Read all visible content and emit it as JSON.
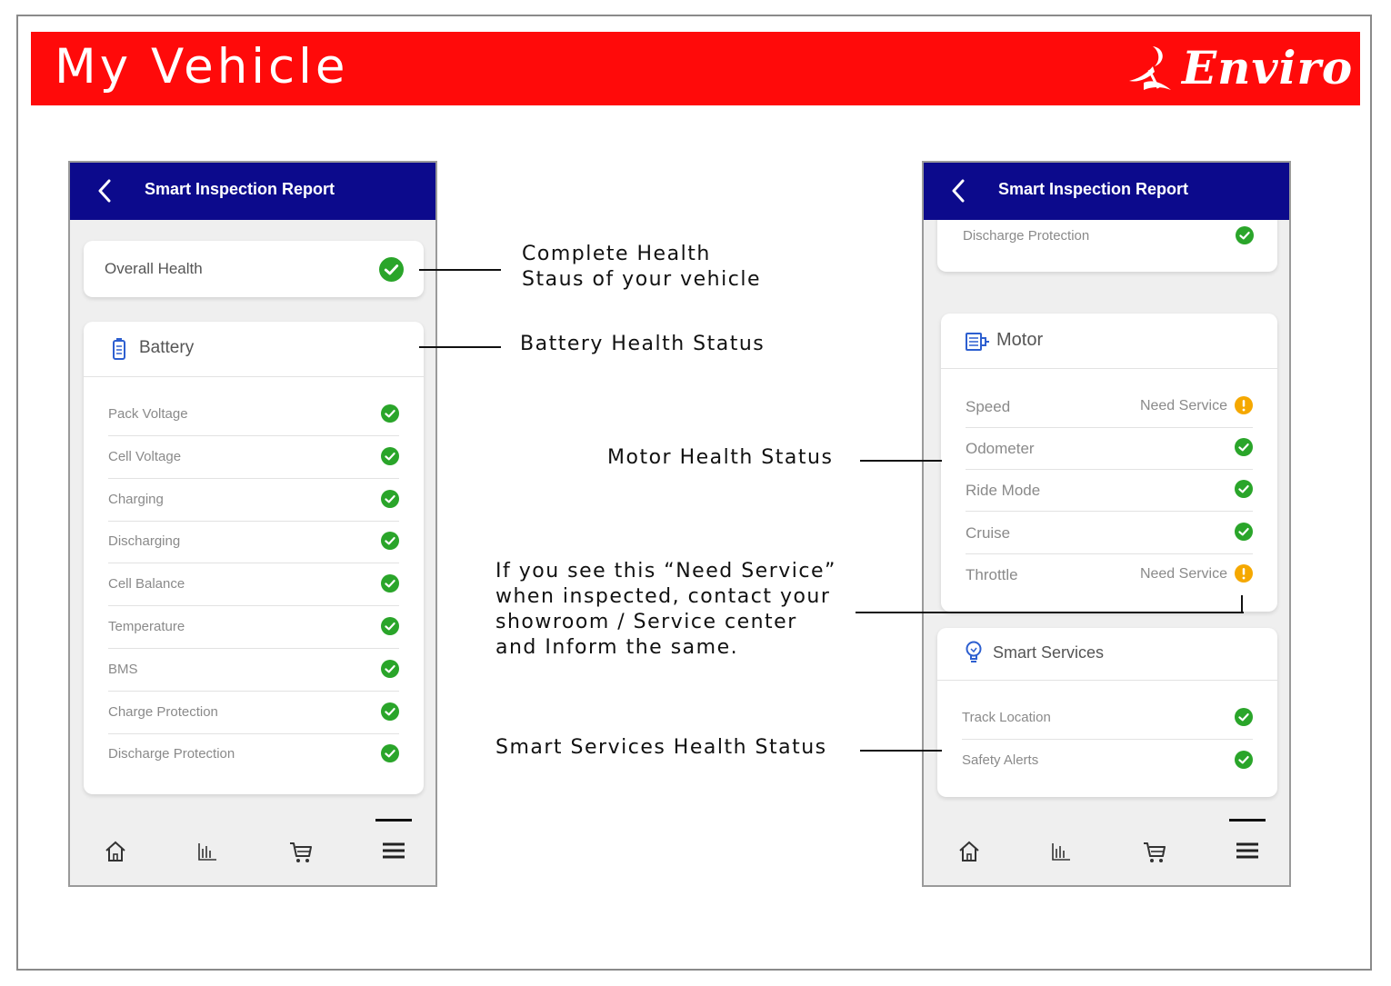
{
  "page": {
    "title": "My Vehicle",
    "brand": "Enviro"
  },
  "colors": {
    "banner": "#ff0a0a",
    "appbar": "#0c0a8c",
    "ok": "#2aa52a",
    "warn": "#f5a800"
  },
  "left_phone": {
    "header": {
      "title": "Smart Inspection Report"
    },
    "overall": {
      "label": "Overall Health",
      "status": "ok"
    },
    "battery": {
      "title": "Battery",
      "icon": "battery-icon",
      "items": [
        {
          "label": "Pack Voltage",
          "status": "ok"
        },
        {
          "label": "Cell Voltage",
          "status": "ok"
        },
        {
          "label": "Charging",
          "status": "ok"
        },
        {
          "label": "Discharging",
          "status": "ok"
        },
        {
          "label": "Cell Balance",
          "status": "ok"
        },
        {
          "label": "Temperature",
          "status": "ok"
        },
        {
          "label": "BMS",
          "status": "ok"
        },
        {
          "label": "Charge Protection",
          "status": "ok"
        },
        {
          "label": "Discharge Protection",
          "status": "ok"
        }
      ]
    },
    "nav": [
      "home-icon",
      "stats-icon",
      "cart-icon",
      "menu-icon"
    ]
  },
  "right_phone": {
    "header": {
      "title": "Smart Inspection Report"
    },
    "top_row": {
      "label": "Discharge Protection",
      "status": "ok"
    },
    "motor": {
      "title": "Motor",
      "icon": "motor-icon",
      "items": [
        {
          "label": "Speed",
          "status": "warn",
          "status_text": "Need Service"
        },
        {
          "label": "Odometer",
          "status": "ok"
        },
        {
          "label": "Ride Mode",
          "status": "ok"
        },
        {
          "label": "Cruise",
          "status": "ok"
        },
        {
          "label": "Throttle",
          "status": "warn",
          "status_text": "Need Service"
        }
      ]
    },
    "smart": {
      "title": "Smart Services",
      "icon": "bulb-icon",
      "items": [
        {
          "label": "Track Location",
          "status": "ok"
        },
        {
          "label": "Safety Alerts",
          "status": "ok"
        }
      ]
    },
    "nav": [
      "home-icon",
      "stats-icon",
      "cart-icon",
      "menu-icon"
    ]
  },
  "annotations": {
    "overall_line1": "Complete Health",
    "overall_line2": "Staus of your vehicle",
    "battery": "Battery Health Status",
    "motor": "Motor Health Status",
    "service_line1": "If you see this “Need Service”",
    "service_line2": "when inspected, contact your",
    "service_line3": "showroom / Service center",
    "service_line4": "and Inform the same.",
    "smart": "Smart Services Health  Status"
  }
}
